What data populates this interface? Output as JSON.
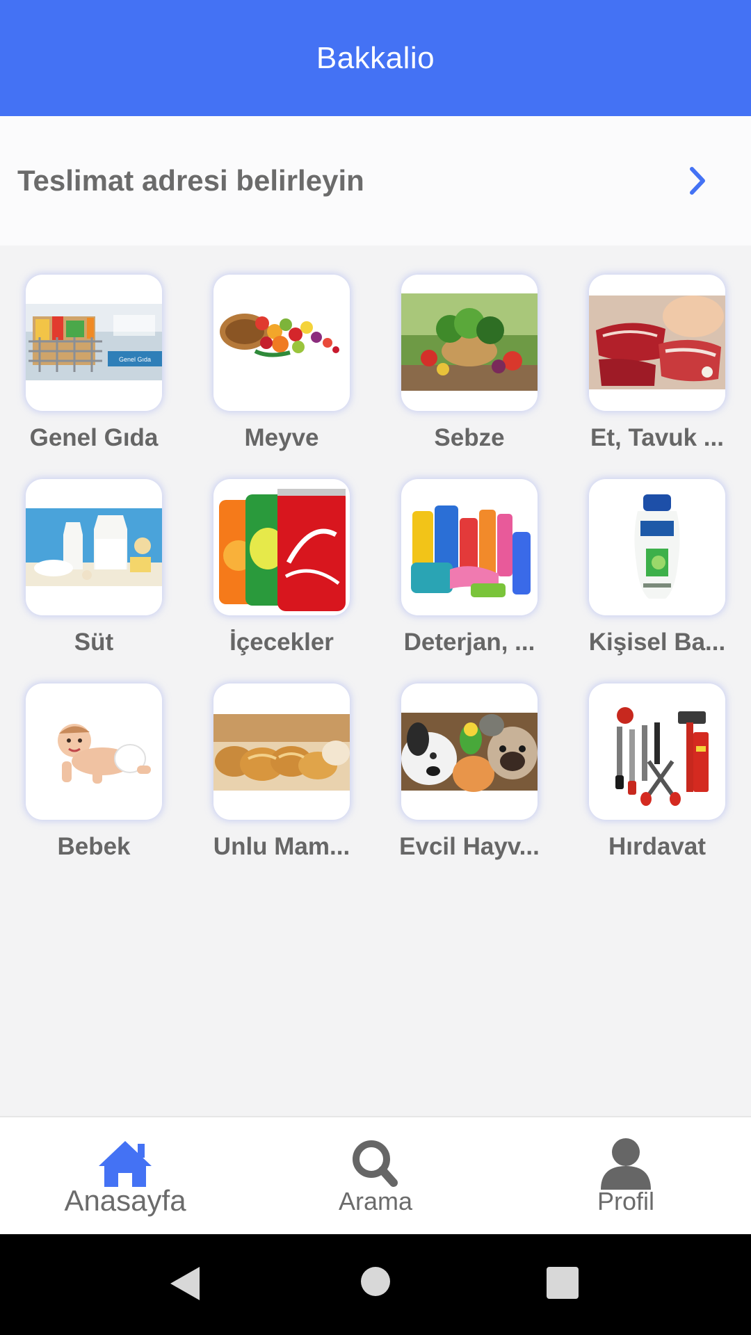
{
  "app_bar": {
    "title": "Bakkalio"
  },
  "address": {
    "label": "Teslimat adresi belirleyin",
    "icon": "chevron-right-icon"
  },
  "categories": [
    {
      "name": "Genel Gıda",
      "image": "grocery-cart-image",
      "image_text": "Genel Gıda"
    },
    {
      "name": "Meyve",
      "image": "fruit-basket-image"
    },
    {
      "name": "Sebze",
      "image": "vegetables-image"
    },
    {
      "name": "Et, Tavuk ...",
      "image": "meat-image"
    },
    {
      "name": "Süt",
      "image": "dairy-image"
    },
    {
      "name": "İçecekler",
      "image": "soda-cans-image"
    },
    {
      "name": "Deterjan, ...",
      "image": "detergent-bottles-image"
    },
    {
      "name": "Kişisel Ba...",
      "image": "shampoo-bottle-image"
    },
    {
      "name": "Bebek",
      "image": "baby-image"
    },
    {
      "name": "Unlu Mam...",
      "image": "bread-image"
    },
    {
      "name": "Evcil Hayv...",
      "image": "pets-image"
    },
    {
      "name": "Hırdavat",
      "image": "tools-image"
    }
  ],
  "bottom_nav": {
    "items": [
      {
        "label": "Anasayfa",
        "icon": "home-icon",
        "active": true
      },
      {
        "label": "Arama",
        "icon": "search-icon",
        "active": false
      },
      {
        "label": "Profil",
        "icon": "profile-icon",
        "active": false
      }
    ]
  },
  "system_nav": [
    "back-icon",
    "home-circle-icon",
    "recents-icon"
  ],
  "colors": {
    "primary": "#4472f4",
    "background": "#f3f3f4",
    "text_gray": "#666666",
    "system_bar": "#000000"
  }
}
